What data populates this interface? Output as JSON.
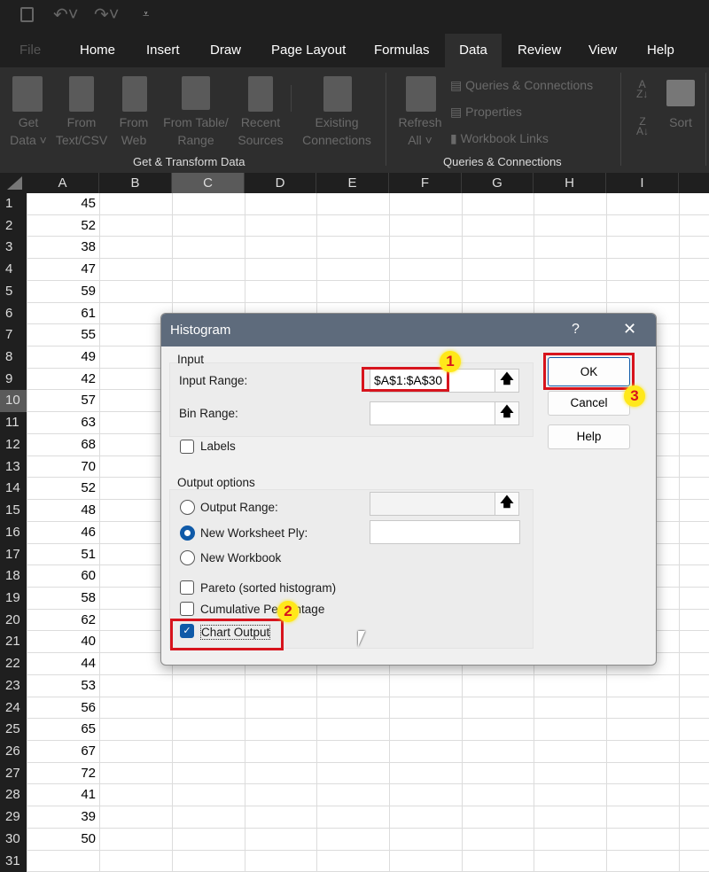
{
  "quick_access": {
    "icons": [
      "save-icon",
      "undo-icon",
      "redo-icon",
      "customize-icon"
    ]
  },
  "tabs": [
    "File",
    "Home",
    "Insert",
    "Draw",
    "Page Layout",
    "Formulas",
    "Data",
    "Review",
    "View",
    "Help"
  ],
  "active_tab": "Data",
  "ribbon": {
    "get_transform": {
      "group_label": "Get & Transform Data",
      "buttons": [
        {
          "l1": "Get",
          "l2": "Data ˅"
        },
        {
          "l1": "From",
          "l2": "Text/CSV"
        },
        {
          "l1": "From",
          "l2": "Web"
        },
        {
          "l1": "From Table/",
          "l2": "Range"
        },
        {
          "l1": "Recent",
          "l2": "Sources"
        },
        {
          "l1": "Existing",
          "l2": "Connections"
        }
      ]
    },
    "queries": {
      "group_label": "Queries & Connections",
      "refresh_l1": "Refresh",
      "refresh_l2": "All ˅",
      "items": [
        "Queries & Connections",
        "Properties",
        "Workbook Links"
      ]
    },
    "sort": {
      "label": "Sort"
    }
  },
  "sheet": {
    "columns": [
      "A",
      "B",
      "C",
      "D",
      "E",
      "F",
      "G",
      "H",
      "I"
    ],
    "active_column": "C",
    "active_row": 10,
    "rows": [
      1,
      2,
      3,
      4,
      5,
      6,
      7,
      8,
      9,
      10,
      11,
      12,
      13,
      14,
      15,
      16,
      17,
      18,
      19,
      20,
      21,
      22,
      23,
      24,
      25,
      26,
      27,
      28,
      29,
      30,
      31
    ],
    "column_a": [
      45,
      52,
      38,
      47,
      59,
      61,
      55,
      49,
      42,
      57,
      63,
      68,
      70,
      52,
      48,
      46,
      51,
      60,
      58,
      62,
      40,
      44,
      53,
      56,
      65,
      67,
      72,
      41,
      39,
      50
    ]
  },
  "dialog": {
    "title": "Histogram",
    "help_glyph": "?",
    "close_glyph": "✕",
    "input_group": "Input",
    "input_range_label": "Input Range:",
    "input_range_value": "$A$1:$A$30",
    "bin_range_label": "Bin Range:",
    "bin_range_value": "",
    "labels_label": "Labels",
    "labels_checked": false,
    "output_group": "Output options",
    "output_range_label": "Output Range:",
    "new_worksheet_label": "New Worksheet Ply:",
    "new_workbook_label": "New Workbook",
    "selected_output": "New Worksheet Ply",
    "pareto_label": "Pareto (sorted histogram)",
    "pareto_checked": false,
    "cumulative_label": "Cumulative Percentage",
    "cumulative_checked": false,
    "chart_output_label": "Chart Output",
    "chart_output_checked": true,
    "ok": "OK",
    "cancel": "Cancel",
    "help": "Help",
    "up_arrow": "🡅"
  },
  "annotations": {
    "badge1": "1",
    "badge2": "2",
    "badge3": "3",
    "highlight_color": "#d7141d",
    "badge_color": "#ffe81a"
  }
}
